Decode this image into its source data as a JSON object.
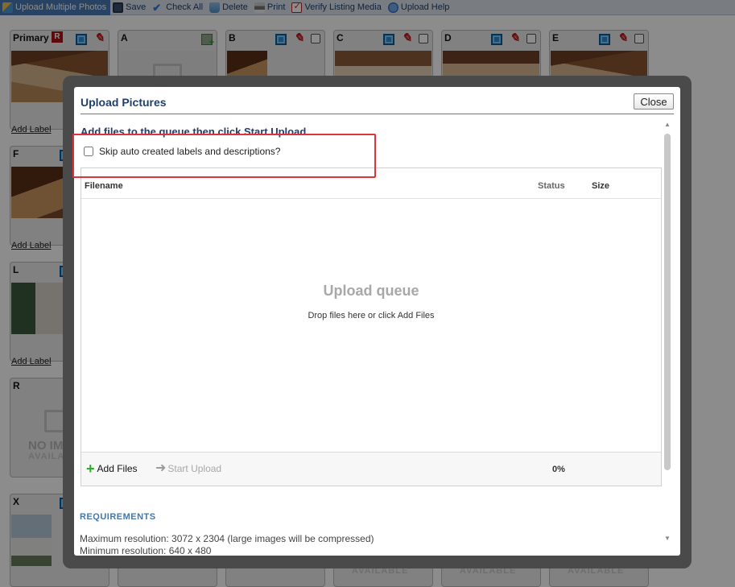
{
  "toolbar": {
    "upload_multiple": "Upload Multiple Photos",
    "save": "Save",
    "check_all": "Check All",
    "delete": "Delete",
    "print": "Print",
    "verify": "Verify Listing Media",
    "help": "Upload Help"
  },
  "grid": {
    "primary_label": "Primary",
    "primary_badge": "R",
    "labels": {
      "a": "A",
      "b": "B",
      "c": "C",
      "d": "D",
      "e": "E",
      "f": "F",
      "l": "L",
      "r": "R",
      "x": "X"
    },
    "add_label": "Add Label",
    "no_image_line1": "NO IMAGE",
    "no_image_line2": "AVAILABLE"
  },
  "modal": {
    "title": "Upload Pictures",
    "close": "Close",
    "instruction": "Add files to the queue then click Start Upload",
    "skip_label": "Skip auto created labels and descriptions?",
    "columns": {
      "filename": "Filename",
      "status": "Status",
      "size": "Size"
    },
    "queue_title": "Upload queue",
    "queue_sub": "Drop files here or click Add Files",
    "add_files": "Add Files",
    "start_upload": "Start Upload",
    "progress": "0%",
    "requirements_title": "REQUIREMENTS",
    "req_max": "Maximum resolution: 3072 x 2304 (large images will be compressed)",
    "req_min": "Minimum resolution: 640 x 480"
  }
}
